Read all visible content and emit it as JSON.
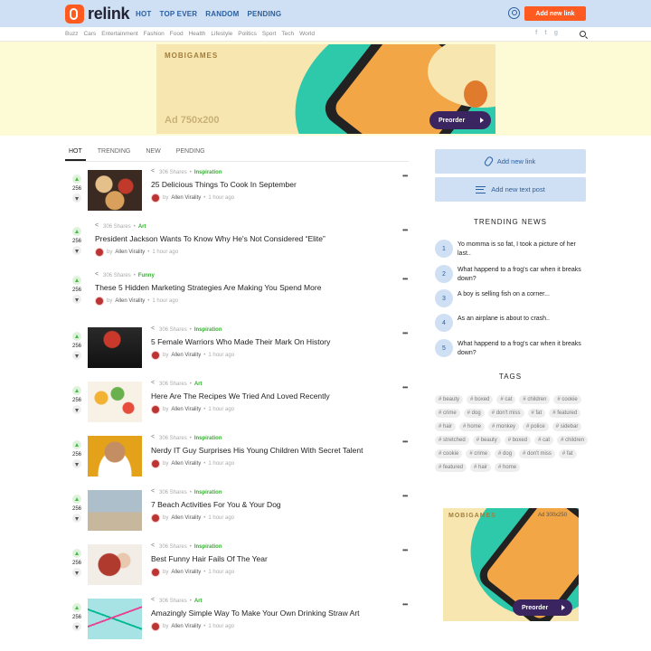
{
  "header": {
    "brand": "relink",
    "nav": [
      "HOT",
      "TOP EVER",
      "RANDOM",
      "PENDING"
    ],
    "add_link_label": "Add new link"
  },
  "subnav": {
    "categories": [
      "Buzz",
      "Cars",
      "Entertainment",
      "Fashion",
      "Food",
      "Health",
      "Lifestyle",
      "Politics",
      "Sport",
      "Tech",
      "World"
    ],
    "social": [
      "f",
      "t",
      "g"
    ]
  },
  "top_ad": {
    "brand": "MOBIGAMES",
    "size_label": "Ad 750x200",
    "cta": "Preorder"
  },
  "tabs": [
    "HOT",
    "TRENDING",
    "NEW",
    "PENDING"
  ],
  "posts": [
    {
      "votes": "256",
      "shares": "306 Shares",
      "category": "Inspiration",
      "title": "25 Delicious Things To Cook In September",
      "author": "Allen Virality",
      "time": "1 hour ago",
      "has_image": true,
      "image": "food"
    },
    {
      "votes": "256",
      "shares": "306 Shares",
      "category": "Art",
      "title": "President Jackson Wants To Know Why He's Not Considered “Elite”",
      "author": "Allen Virality",
      "time": "1 hour ago",
      "has_image": false
    },
    {
      "votes": "256",
      "shares": "306 Shares",
      "category": "Funny",
      "title": "These 5 Hidden Marketing Strategies Are Making You Spend More",
      "author": "Allen Virality",
      "time": "1 hour ago",
      "has_image": false
    },
    {
      "votes": "256",
      "shares": "306 Shares",
      "category": "Inspiration",
      "title": "5 Female Warriors Who Made Their Mark On History",
      "author": "Allen Virality",
      "time": "1 hour ago",
      "has_image": true,
      "image": "boxer"
    },
    {
      "votes": "256",
      "shares": "306 Shares",
      "category": "Art",
      "title": "Here Are The Recipes We Tried And Loved Recently",
      "author": "Allen Virality",
      "time": "1 hour ago",
      "has_image": true,
      "image": "veggies"
    },
    {
      "votes": "256",
      "shares": "306 Shares",
      "category": "Inspiration",
      "title": "Nerdy IT Guy Surprises His Young Children With Secret Talent",
      "author": "Allen Virality",
      "time": "1 hour ago",
      "has_image": true,
      "image": "man"
    },
    {
      "votes": "256",
      "shares": "306 Shares",
      "category": "Inspiration",
      "title": "7 Beach Activities For You & Your Dog",
      "author": "Allen Virality",
      "time": "1 hour ago",
      "has_image": true,
      "image": "beach"
    },
    {
      "votes": "256",
      "shares": "306 Shares",
      "category": "Inspiration",
      "title": "Best Funny Hair Fails Of The Year",
      "author": "Allen Virality",
      "time": "1 hour ago",
      "has_image": true,
      "image": "hair"
    },
    {
      "votes": "256",
      "shares": "306 Shares",
      "category": "Art",
      "title": "Amazingly Simple Way To Make Your Own Drinking Straw Art",
      "author": "Allen Virality",
      "time": "1 hour ago",
      "has_image": true,
      "image": "straw"
    }
  ],
  "sidebar": {
    "add_link": "Add new link",
    "add_text": "Add new text post",
    "trending_heading": "TRENDING NEWS",
    "trending": [
      {
        "num": "1",
        "text": "Yo momma is so fat, I took a picture of her last.."
      },
      {
        "num": "2",
        "text": "What happend to a frog's car when it breaks down?"
      },
      {
        "num": "3",
        "text": "A boy is selling fish on a corner..."
      },
      {
        "num": "4",
        "text": "As an airplane is about to crash.."
      },
      {
        "num": "5",
        "text": "What happend to a frog's car when it breaks down?"
      }
    ],
    "tags_heading": "TAGS",
    "tags": [
      "# beauty",
      "# boxed",
      "# cat",
      "# children",
      "# cookie",
      "# crime",
      "# dog",
      "# don't miss",
      "# fat",
      "# featured",
      "# hair",
      "# home",
      "# monkey",
      "# police",
      "# sidebar",
      "# stretched",
      "# beauty",
      "# boxed",
      "# cat",
      "# children",
      "# cookie",
      "# crime",
      "# dog",
      "# don't miss",
      "# fat",
      "# featured",
      "# hair",
      "# home"
    ],
    "ad": {
      "brand": "MOBIGAMES",
      "size_label": "Ad 300x250",
      "cta": "Preorder"
    }
  },
  "colors": {
    "accent": "#ff5a1f",
    "header_bg": "#cfe0f4",
    "category": "#35b02f",
    "link": "#2a5fa0"
  }
}
